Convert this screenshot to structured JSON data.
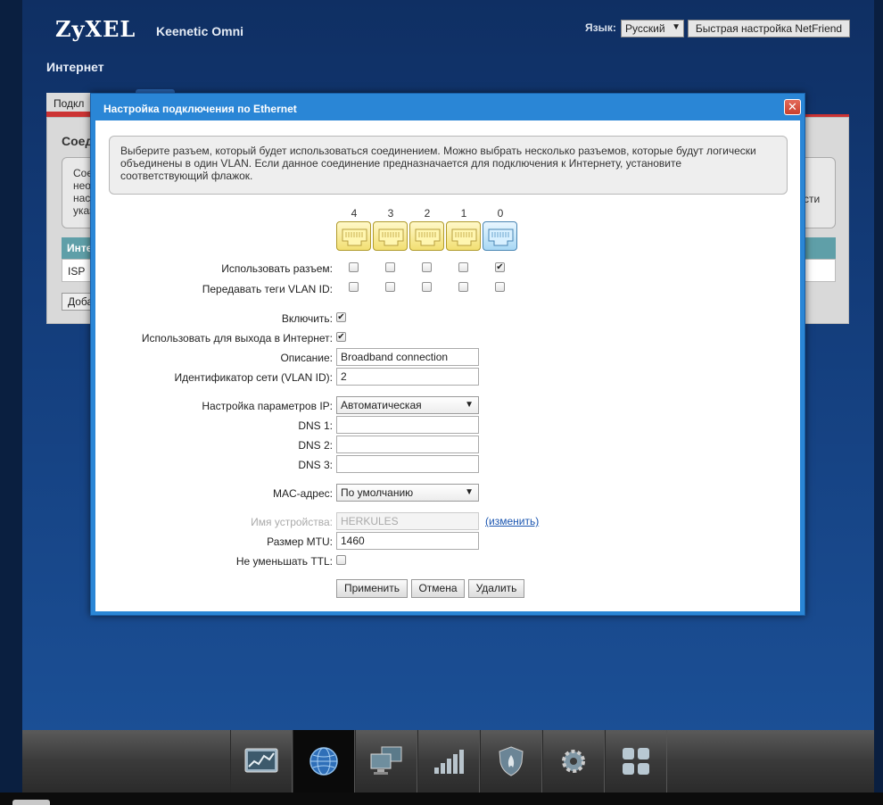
{
  "header": {
    "brand": "ZyXEL",
    "model": "Keenetic Omni",
    "lang_label": "Язык:",
    "lang_value": "Русский",
    "quick_setup": "Быстрая настройка NetFriend",
    "page_title": "Интернет"
  },
  "background": {
    "tab_label": "Подкл",
    "panel_title": "Соед",
    "info_lines": [
      "Сое",
      "нео",
      "нас",
      "указ"
    ],
    "info_right": "сти",
    "table_header": "Инте",
    "table_row": "ISP",
    "add_button": "Доба"
  },
  "modal": {
    "title": "Настройка подключения по Ethernet",
    "close": "✕",
    "hint_lines": [
      "Выберите разъем, который будет использоваться соединением. Можно выбрать несколько разъемов, которые будут логически",
      "объединены в один VLAN. Если данное соединение предназначается для подключения к Интернету, установите",
      "соответствующий флажок."
    ],
    "ports": [
      "4",
      "3",
      "2",
      "1",
      "0"
    ],
    "use_port_label": "Использовать разъем:",
    "use_port_checked": [
      false,
      false,
      false,
      false,
      true
    ],
    "vlan_tags_label": "Передавать теги VLAN ID:",
    "vlan_tags_checked": [
      false,
      false,
      false,
      false,
      false
    ],
    "enable_label": "Включить:",
    "enable_checked": true,
    "internet_label": "Использовать для выхода в Интернет:",
    "internet_checked": true,
    "description_label": "Описание:",
    "description_value": "Broadband connection",
    "vlan_id_label": "Идентификатор сети (VLAN ID):",
    "vlan_id_value": "2",
    "ip_label": "Настройка параметров IP:",
    "ip_value": "Автоматическая",
    "dns1_label": "DNS 1:",
    "dns1_value": "",
    "dns2_label": "DNS 2:",
    "dns2_value": "",
    "dns3_label": "DNS 3:",
    "dns3_value": "",
    "mac_label": "MAC-адрес:",
    "mac_value": "По умолчанию",
    "device_name_label": "Имя устройства:",
    "device_name_value": "HERKULES",
    "change_link": "(изменить)",
    "mtu_label": "Размер MTU:",
    "mtu_value": "1460",
    "ttl_label": "Не уменьшать TTL:",
    "ttl_checked": false,
    "apply_button": "Применить",
    "cancel_button": "Отмена",
    "delete_button": "Удалить"
  },
  "bottom_nav": {
    "items": [
      "monitor-icon",
      "internet-globe-icon",
      "home-network-icon",
      "wifi-signal-icon",
      "security-shield-icon",
      "settings-gear-icon",
      "apps-grid-icon"
    ],
    "active_index": 1
  },
  "colors": {
    "modal_header": "#2a86d6",
    "accent_red": "#cc3333",
    "page_bg": "#133c7a"
  }
}
